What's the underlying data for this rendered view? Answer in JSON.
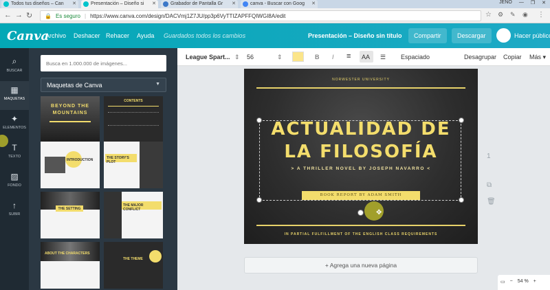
{
  "browser": {
    "tabs": [
      {
        "label": "Todos tus diseños – Can"
      },
      {
        "label": "Presentación – Diseño si"
      },
      {
        "label": "Grabador de Pantalla Gr"
      },
      {
        "label": "canva - Buscar con Goog"
      }
    ],
    "window_controls": [
      "JENO",
      "—",
      "❐",
      "✕"
    ],
    "secure_label": "Es seguro",
    "url": "https://www.canva.com/design/DACVmj1Z7JU/pp3p6VyTTIZAPFFQIWGI8A/edit"
  },
  "app": {
    "logo": "Canva",
    "menu": [
      "Archivo",
      "Deshacer",
      "Rehacer",
      "Ayuda"
    ],
    "saved_status": "Guardados todos los cambios",
    "doc_title": "Presentación – Diseño sin título",
    "share_label": "Compartir",
    "download_label": "Descargar",
    "publish_label": "Hacer público",
    "accent": "#03a8b6"
  },
  "rail": [
    {
      "label": "BUSCAR",
      "icon": "search-icon",
      "glyph": "⌕"
    },
    {
      "label": "MAQUETAS",
      "icon": "layouts-icon",
      "glyph": "▦"
    },
    {
      "label": "ELEMENTOS",
      "icon": "elements-icon",
      "glyph": "✦"
    },
    {
      "label": "TEXTO",
      "icon": "text-icon",
      "glyph": "T"
    },
    {
      "label": "FONDO",
      "icon": "background-icon",
      "glyph": "▨"
    },
    {
      "label": "SUBIR",
      "icon": "upload-icon",
      "glyph": "↑"
    }
  ],
  "panel": {
    "search_placeholder": "Busca en 1.000.000 de imágenes...",
    "dropdown_value": "Maquetas de Canva",
    "templates": [
      {
        "text": "BEYOND THE MOUNTAINS"
      },
      {
        "text": "CONTENTS"
      },
      {
        "text": "INTRODUCTION"
      },
      {
        "text": "THE STORY'S PLOT"
      },
      {
        "text": "THE SETTING"
      },
      {
        "text": "THE MAJOR CONFLICT"
      },
      {
        "text": "ABOUT THE CHARACTERS"
      },
      {
        "text": "THE THEME"
      }
    ]
  },
  "toolbar": {
    "font": "League Spart...",
    "size": "56",
    "color": "#fbe58a",
    "bold": "B",
    "italic": "I",
    "align": "≡",
    "case": "AA",
    "list": "☰",
    "spacing": "Espaciado",
    "ungroup": "Desagrupar",
    "copy": "Copiar",
    "more": "Más ▾"
  },
  "slide": {
    "university": "NORWESTER UNIVERSITY",
    "title_line1": "ACTUALIDAD DE",
    "title_line2": "LA FILOSOFÍA",
    "subtitle": "> A THRILLER NOVEL BY JOSEPH NAVARRO <",
    "book_report": "BOOK REPORT BY ADAM SMITH",
    "fulfillment": "IN PARTIAL FULFILLMENT OF THE ENGLISH CLASS REQUIREMENTS"
  },
  "add_page": "+ Agrega una nueva página",
  "zoom": {
    "minus": "−",
    "value": "54 %",
    "plus": "+"
  },
  "side_numbers": [
    "1"
  ]
}
